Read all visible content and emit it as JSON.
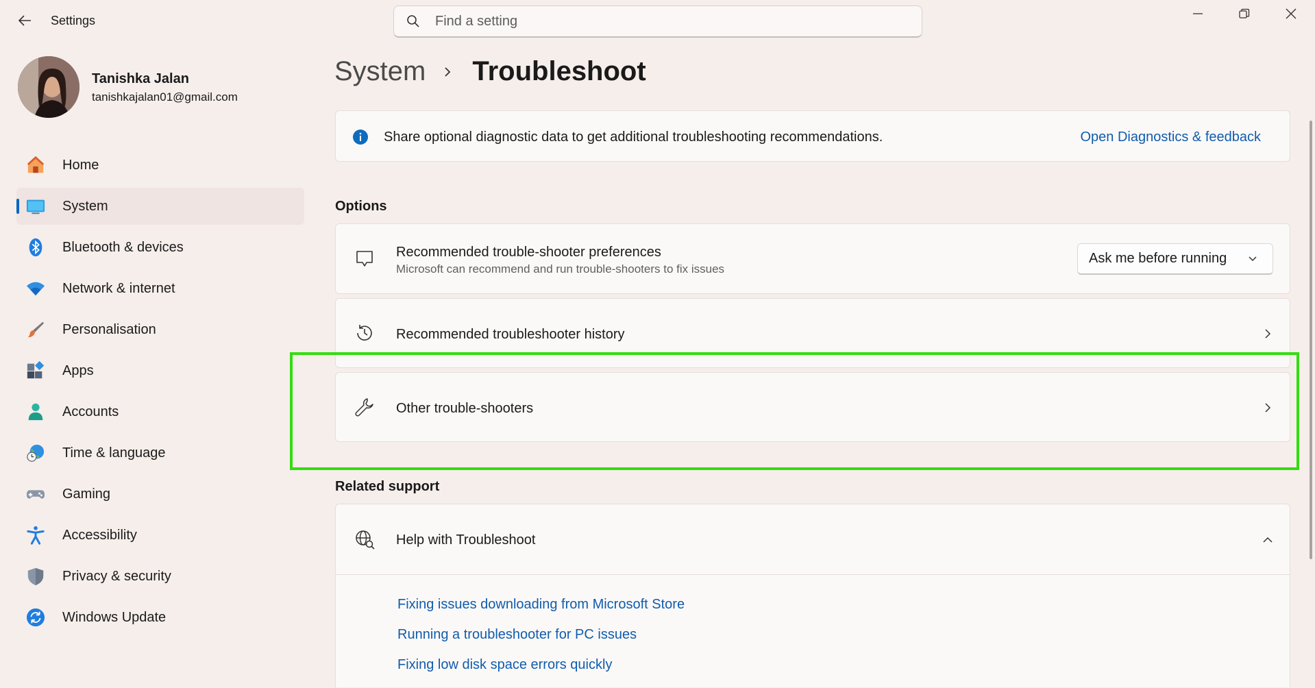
{
  "window": {
    "app_title": "Settings",
    "search_placeholder": "Find a setting"
  },
  "profile": {
    "name": "Tanishka Jalan",
    "email": "tanishkajalan01@gmail.com"
  },
  "sidebar": {
    "items": [
      {
        "label": "Home",
        "icon": "home-icon",
        "active": false
      },
      {
        "label": "System",
        "icon": "system-icon",
        "active": true
      },
      {
        "label": "Bluetooth & devices",
        "icon": "bluetooth-icon",
        "active": false
      },
      {
        "label": "Network & internet",
        "icon": "wifi-icon",
        "active": false
      },
      {
        "label": "Personalisation",
        "icon": "brush-icon",
        "active": false
      },
      {
        "label": "Apps",
        "icon": "apps-icon",
        "active": false
      },
      {
        "label": "Accounts",
        "icon": "account-icon",
        "active": false
      },
      {
        "label": "Time & language",
        "icon": "globe-clock-icon",
        "active": false
      },
      {
        "label": "Gaming",
        "icon": "gamepad-icon",
        "active": false
      },
      {
        "label": "Accessibility",
        "icon": "accessibility-icon",
        "active": false
      },
      {
        "label": "Privacy & security",
        "icon": "shield-icon",
        "active": false
      },
      {
        "label": "Windows Update",
        "icon": "update-icon",
        "active": false
      }
    ]
  },
  "breadcrumb": {
    "parent": "System",
    "current": "Troubleshoot"
  },
  "info_banner": {
    "text": "Share optional diagnostic data to get additional troubleshooting recommendations.",
    "link": "Open Diagnostics & feedback"
  },
  "options": {
    "title": "Options",
    "preferences": {
      "title": "Recommended trouble-shooter preferences",
      "subtitle": "Microsoft can recommend and run trouble-shooters to fix issues",
      "dropdown_value": "Ask me before running"
    },
    "history": {
      "title": "Recommended troubleshooter history"
    },
    "other": {
      "title": "Other trouble-shooters"
    }
  },
  "related": {
    "title": "Related support",
    "help_title": "Help with Troubleshoot",
    "links": [
      "Fixing issues downloading from Microsoft Store",
      "Running a troubleshooter for PC issues",
      "Fixing low disk space errors quickly"
    ]
  },
  "colors": {
    "accent": "#0067c0",
    "link": "#0f5cad",
    "highlight": "#33dd11",
    "background": "#f6eeeb"
  }
}
